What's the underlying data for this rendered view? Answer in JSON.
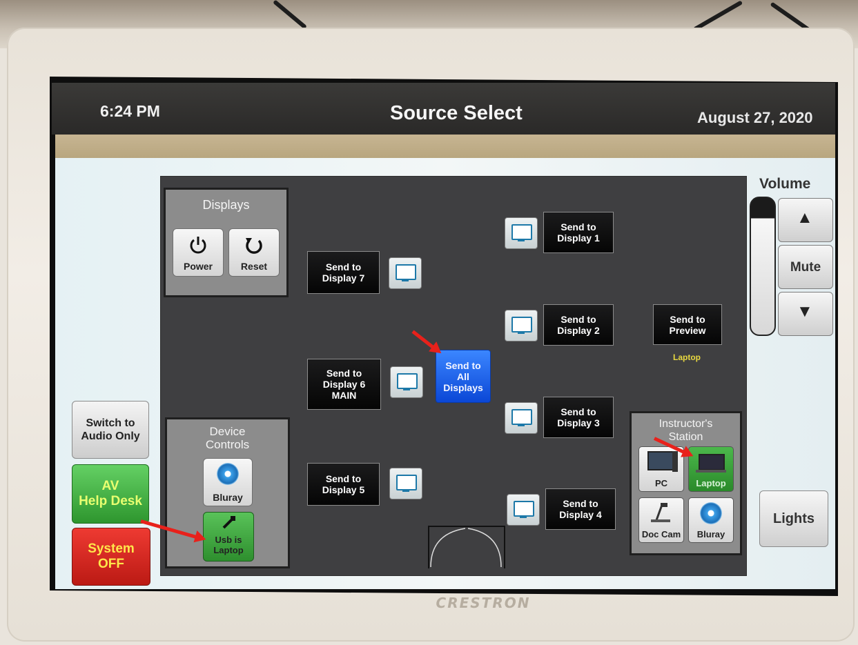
{
  "header": {
    "time": "6:24 PM",
    "title": "Source Select",
    "date": "August 27, 2020"
  },
  "displays_panel": {
    "title": "Displays",
    "power_label": "Power",
    "reset_label": "Reset"
  },
  "device_controls": {
    "title": "Device\nControls",
    "bluray_label": "Bluray",
    "usb_label": "Usb is\nLaptop"
  },
  "send_buttons": {
    "display1": "Send to\nDisplay 1",
    "display2": "Send to\nDisplay 2",
    "display3": "Send to\nDisplay 3",
    "display4": "Send to\nDisplay 4",
    "display5": "Send to\nDisplay 5",
    "display6": "Send to\nDisplay 6\nMAIN",
    "display7": "Send to\nDisplay 7",
    "all": "Send to\nAll\nDisplays",
    "preview": "Send to\nPreview"
  },
  "preview_source": "Laptop",
  "instructor_station": {
    "title": "Instructor's\nStation",
    "pc_label": "PC",
    "laptop_label": "Laptop",
    "doccam_label": "Doc Cam",
    "bluray_label": "Bluray"
  },
  "volume": {
    "title": "Volume",
    "mute_label": "Mute",
    "level": 0.85
  },
  "side_buttons": {
    "audio_only": "Switch to\nAudio Only",
    "help_desk": "AV\nHelp Desk",
    "system_off": "System\nOFF",
    "lights": "Lights"
  },
  "brand": "CRESTRON",
  "colors": {
    "active_green": "#3aa83a",
    "send_all_blue": "#1a5cf0",
    "system_off_red": "#d9261f",
    "preview_label_yellow": "#e8d840"
  }
}
